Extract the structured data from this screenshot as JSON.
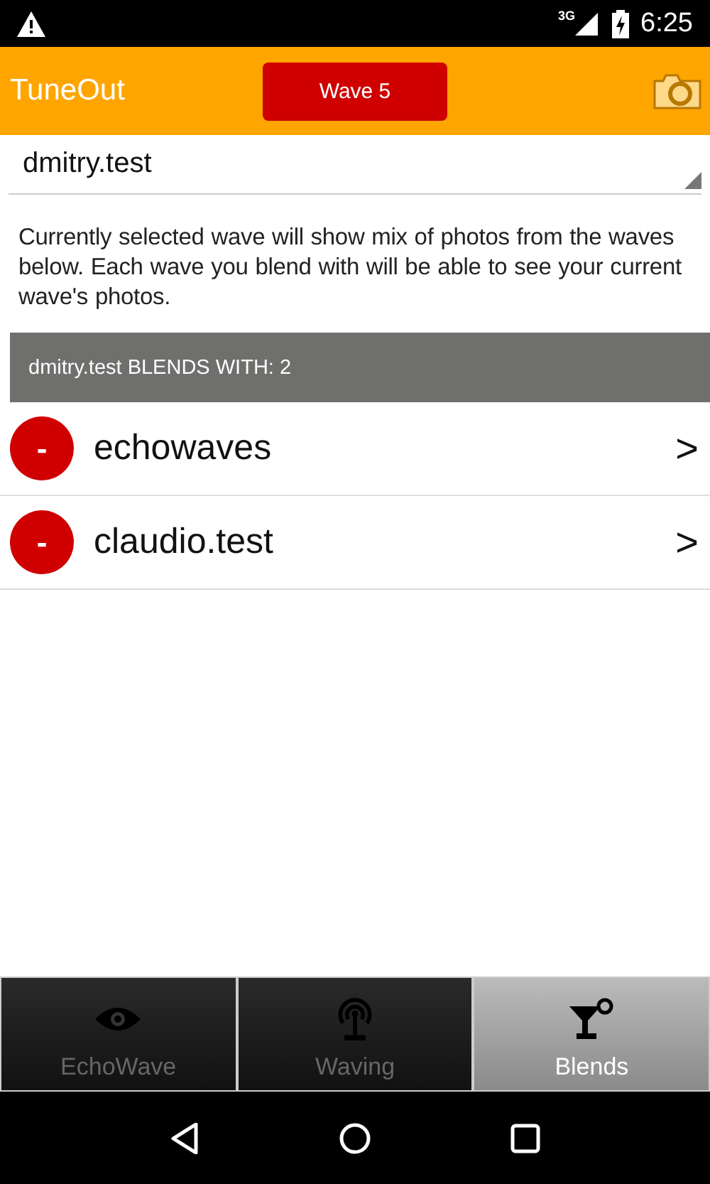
{
  "status_bar": {
    "network": "3G",
    "time": "6:25"
  },
  "app_bar": {
    "title": "TuneOut",
    "wave_button": "Wave 5"
  },
  "wave_spinner": {
    "value": "dmitry.test"
  },
  "description": "Currently selected wave will show mix of photos from the waves below. Each wave you blend with will be able to see your current wave's photos.",
  "section_header": "dmitry.test BLENDS WITH: 2",
  "blends": [
    {
      "remove": "-",
      "name": "echowaves",
      "chevron": ">"
    },
    {
      "remove": "-",
      "name": "claudio.test",
      "chevron": ">"
    }
  ],
  "tabs": [
    {
      "label": "EchoWave",
      "kind": "eye",
      "selected": false
    },
    {
      "label": "Waving",
      "kind": "antenna",
      "selected": false
    },
    {
      "label": "Blends",
      "kind": "cocktail",
      "selected": true
    }
  ]
}
